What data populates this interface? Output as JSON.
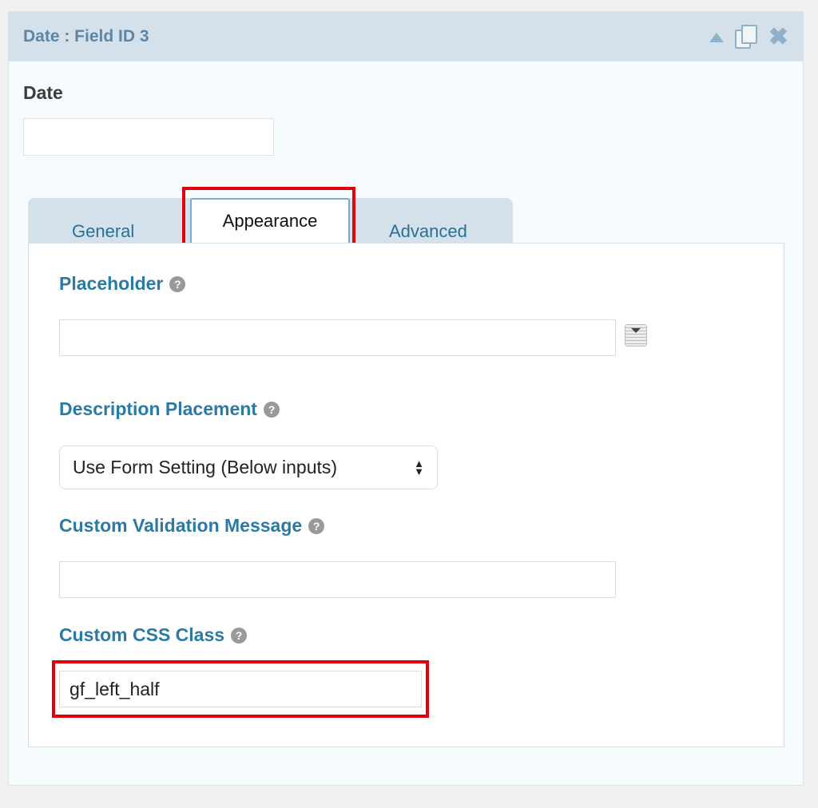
{
  "header": {
    "title": "Date : Field ID 3",
    "icons": [
      "collapse-arrow-icon",
      "duplicate-icon",
      "close-icon"
    ]
  },
  "field": {
    "label": "Date",
    "value": ""
  },
  "tabs": [
    {
      "label": "General"
    },
    {
      "label": "Appearance",
      "active": true
    },
    {
      "label": "Advanced"
    }
  ],
  "appearance": {
    "placeholder": {
      "label": "Placeholder",
      "value": ""
    },
    "description_placement": {
      "label": "Description Placement",
      "selected": "Use Form Setting (Below inputs)"
    },
    "validation": {
      "label": "Custom Validation Message",
      "value": ""
    },
    "css_class": {
      "label": "Custom CSS Class",
      "value": "gf_left_half"
    },
    "help_glyph": "?"
  },
  "highlight_color": "#e0000b"
}
